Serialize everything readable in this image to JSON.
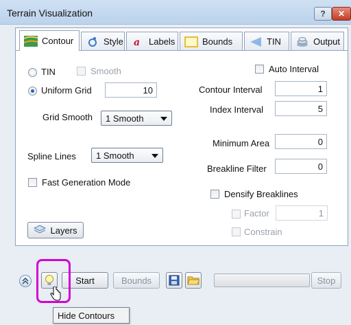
{
  "window": {
    "title": "Terrain Visualization",
    "help_label": "?",
    "close_label": "✕"
  },
  "tabs": [
    {
      "label": "Contour",
      "icon": "contour-icon",
      "active": true
    },
    {
      "label": "Style",
      "icon": "style-icon"
    },
    {
      "label": "Labels",
      "icon": "labels-icon"
    },
    {
      "label": "Bounds",
      "icon": "bounds-icon"
    },
    {
      "label": "TIN",
      "icon": "tin-icon"
    },
    {
      "label": "Output",
      "icon": "output-icon"
    }
  ],
  "left": {
    "tin_label": "TIN",
    "smooth_label": "Smooth",
    "uniform_grid_label": "Uniform Grid",
    "uniform_grid_value": "10",
    "grid_smooth_label": "Grid Smooth",
    "grid_smooth_value": "1 Smooth",
    "spline_lines_label": "Spline Lines",
    "spline_lines_value": "1 Smooth",
    "fast_generation_label": "Fast Generation Mode",
    "layers_label": "Layers"
  },
  "right": {
    "auto_interval_label": "Auto Interval",
    "contour_interval_label": "Contour Interval",
    "contour_interval_value": "1",
    "index_interval_label": "Index Interval",
    "index_interval_value": "5",
    "minimum_area_label": "Minimum Area",
    "minimum_area_value": "0",
    "breakline_filter_label": "Breakline Filter",
    "breakline_filter_value": "0",
    "densify_breaklines_label": "Densify Breaklines",
    "factor_label": "Factor",
    "factor_value": "1",
    "constrain_label": "Constrain"
  },
  "toolbar": {
    "start_label": "Start",
    "bounds_label": "Bounds",
    "stop_label": "Stop",
    "progress": 0
  },
  "tooltip": {
    "text": "Hide Contours"
  },
  "colors": {
    "accent": "#2a62b8",
    "highlight": "#d400d4"
  }
}
